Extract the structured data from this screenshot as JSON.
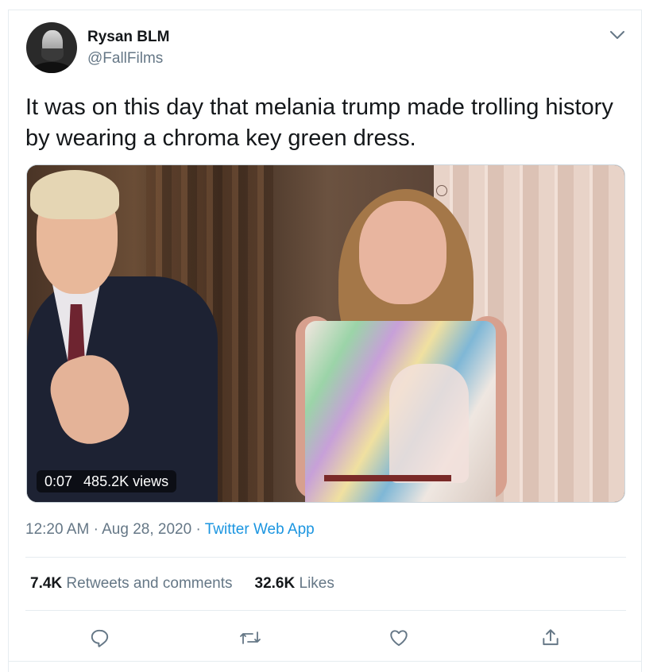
{
  "tweet": {
    "author_name": "Rysan BLM",
    "author_handle": "@FallFilms",
    "text": "It was on this day that melania trump made trolling history by wearing a chroma key green dress.",
    "timestamp": "12:20 AM",
    "separator1": "·",
    "date": "Aug 28, 2020",
    "separator2": "·",
    "source": "Twitter Web App"
  },
  "media": {
    "duration": "0:07",
    "views": "485.2K views"
  },
  "stats": {
    "retweets_count": "7.4K",
    "retweets_label": "Retweets and comments",
    "likes_count": "32.6K",
    "likes_label": "Likes"
  },
  "icons": {
    "menu": "chevron-down-icon",
    "reply": "reply-icon",
    "retweet": "retweet-icon",
    "like": "heart-icon",
    "share": "share-icon"
  },
  "colors": {
    "text": "#14171a",
    "secondary": "#657786",
    "link": "#1b95e0",
    "divider": "#e6ecf0"
  }
}
